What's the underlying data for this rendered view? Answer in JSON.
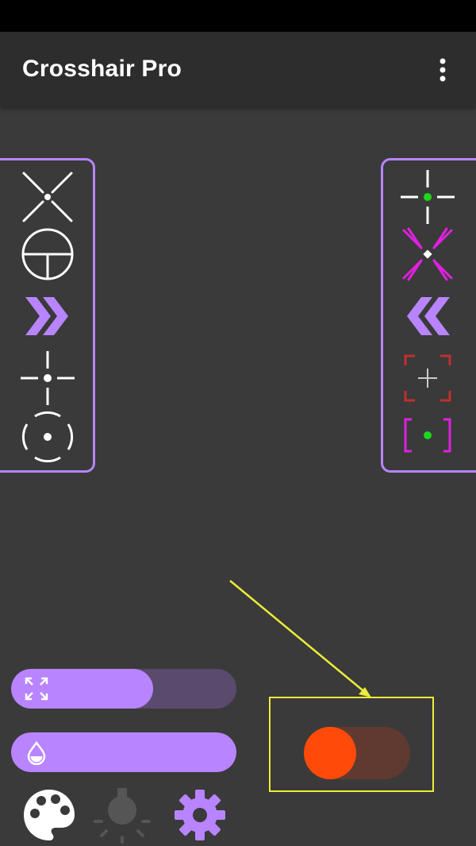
{
  "app": {
    "title": "Crosshair Pro"
  },
  "colors": {
    "accent": "#b884ff",
    "background": "#3a3a3a",
    "appbar": "#2d2d2d",
    "toggle_thumb": "#ff4a0a",
    "toggle_track": "#603a30",
    "annotation": "#ecec3a"
  },
  "menu": {
    "icon": "more-vert-icon"
  },
  "left_panel": {
    "crosshairs": [
      {
        "name": "x-dot-crosshair-icon"
      },
      {
        "name": "scope-t-crosshair-icon"
      },
      {
        "name": "chevron-right-crosshair-icon"
      },
      {
        "name": "cross-dot-crosshair-icon"
      },
      {
        "name": "circle-dot-crosshair-icon"
      }
    ]
  },
  "right_panel": {
    "crosshairs": [
      {
        "name": "green-dot-cross-crosshair-icon"
      },
      {
        "name": "magenta-x-crosshair-icon"
      },
      {
        "name": "chevron-left-crosshair-icon"
      },
      {
        "name": "red-bracket-crosshair-icon"
      },
      {
        "name": "magenta-bracket-dot-crosshair-icon"
      }
    ]
  },
  "controls": {
    "size_slider": {
      "icon": "expand-icon",
      "value_fraction": 0.63
    },
    "opacity_slider": {
      "icon": "opacity-drop-icon",
      "value_fraction": 1.0
    },
    "toggle": {
      "state": "off"
    }
  },
  "bottom_bar": [
    {
      "name": "palette-icon"
    },
    {
      "name": "brightness-icon"
    },
    {
      "name": "settings-gear-icon"
    }
  ]
}
